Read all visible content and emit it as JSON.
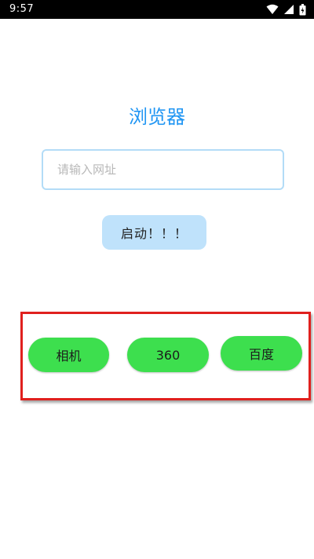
{
  "status_bar": {
    "time": "9:57",
    "icons": [
      "wifi-icon",
      "signal-icon",
      "battery-icon"
    ],
    "background": "#000000"
  },
  "app": {
    "title": "浏览器",
    "title_color": "#2196f3"
  },
  "url_input": {
    "placeholder": "请输入网址",
    "value": ""
  },
  "start_button": {
    "label": "启动！！！",
    "color": "#bfe2fb"
  },
  "highlight": {
    "border_color": "#e0201e"
  },
  "quick_buttons": {
    "color": "#3ddf4e",
    "camera": "相机",
    "browser_360": "360",
    "baidu": "百度"
  }
}
